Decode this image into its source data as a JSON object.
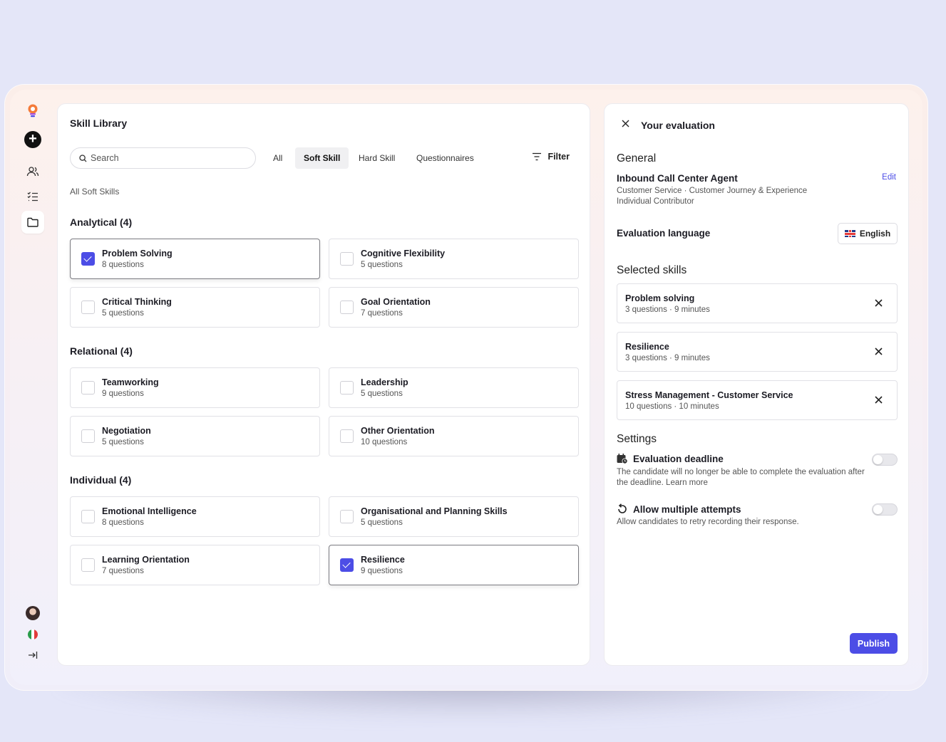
{
  "sidebar": {
    "items": [
      {
        "icon": "logo-icon"
      },
      {
        "icon": "plus-icon"
      },
      {
        "icon": "users-icon"
      },
      {
        "icon": "checklist-icon"
      },
      {
        "icon": "folder-icon"
      }
    ],
    "bottom": [
      {
        "icon": "avatar"
      },
      {
        "icon": "italy-flag-icon"
      },
      {
        "icon": "collapse-icon"
      }
    ]
  },
  "library": {
    "title": "Skill Library",
    "search_placeholder": "Search",
    "tabs": [
      "All",
      "Soft Skill",
      "Hard Skill",
      "Questionnaires"
    ],
    "active_tab": "Soft Skill",
    "filter_label": "Filter",
    "subheading": "All Soft Skills",
    "groups": [
      {
        "title": "Analytical (4)",
        "skills": [
          {
            "name": "Problem Solving",
            "questions": "8 questions",
            "checked": true
          },
          {
            "name": "Cognitive Flexibility",
            "questions": "5 questions",
            "checked": false
          },
          {
            "name": "Critical Thinking",
            "questions": "5 questions",
            "checked": false
          },
          {
            "name": "Goal Orientation",
            "questions": "7 questions",
            "checked": false
          }
        ]
      },
      {
        "title": "Relational (4)",
        "skills": [
          {
            "name": "Teamworking",
            "questions": "9 questions",
            "checked": false
          },
          {
            "name": "Leadership",
            "questions": "5 questions",
            "checked": false
          },
          {
            "name": "Negotiation",
            "questions": "5 questions",
            "checked": false
          },
          {
            "name": "Other Orientation",
            "questions": "10 questions",
            "checked": false
          }
        ]
      },
      {
        "title": "Individual (4)",
        "skills": [
          {
            "name": "Emotional Intelligence",
            "questions": "8 questions",
            "checked": false
          },
          {
            "name": "Organisational and Planning Skills",
            "questions": "5 questions",
            "checked": false
          },
          {
            "name": "Learning Orientation",
            "questions": "7 questions",
            "checked": false
          },
          {
            "name": "Resilience",
            "questions": "9 questions",
            "checked": true
          }
        ]
      }
    ]
  },
  "evaluation": {
    "title": "Your evaluation",
    "general_label": "General",
    "job_title": "Inbound Call Center Agent",
    "job_meta_1": "Customer Service · Customer Journey & Experience",
    "job_meta_2": "Individual Contributor",
    "edit_label": "Edit",
    "language_label": "Evaluation language",
    "language_value": "English",
    "selected_label": "Selected skills",
    "selected": [
      {
        "name": "Problem solving",
        "meta": "3 questions · 9 minutes"
      },
      {
        "name": "Resilience",
        "meta": "3 questions · 9 minutes"
      },
      {
        "name": "Stress Management - Customer Service",
        "meta": "10 questions · 10 minutes"
      }
    ],
    "settings_label": "Settings",
    "deadline_title": "Evaluation deadline",
    "deadline_desc": "The candidate will no longer be able to complete the evaluation after the deadline. Learn more",
    "deadline_enabled": false,
    "attempts_title": "Allow multiple attempts",
    "attempts_desc": "Allow candidates to retry recording their response.",
    "attempts_enabled": false,
    "publish_label": "Publish"
  },
  "colors": {
    "accent": "#4c4de6",
    "background": "#e4e6f8"
  }
}
